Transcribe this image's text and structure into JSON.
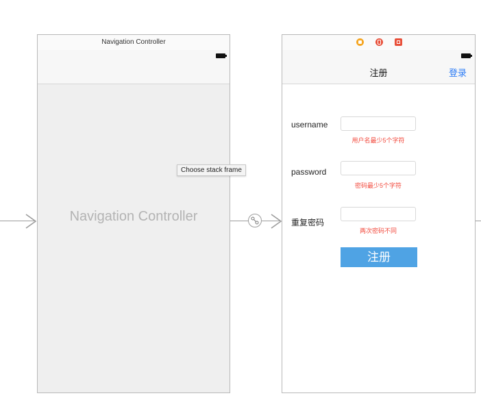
{
  "nav_controller_scene": {
    "title_bar": "Navigation Controller",
    "center_label": "Navigation Controller"
  },
  "tooltip": "Choose stack frame",
  "register_scene": {
    "icons": [
      "view-controller-icon",
      "first-responder-icon",
      "exit-icon"
    ],
    "icon_colors": {
      "view_controller": "#f5a623",
      "first_responder": "#e8503a",
      "exit": "#e8503a"
    },
    "nav_title": "注册",
    "nav_right_button": "登录",
    "fields": [
      {
        "label": "username",
        "value": "",
        "error": "用户名最少5个字符"
      },
      {
        "label": "password",
        "value": "",
        "error": "密码最少5个字符"
      },
      {
        "label": "重复密码",
        "value": "",
        "error": "两次密码不同"
      }
    ],
    "submit_label": "注册"
  },
  "colors": {
    "accent_blue": "#2d7cf6",
    "button_blue": "#4fa3e4",
    "error_red": "#f24a3d"
  }
}
